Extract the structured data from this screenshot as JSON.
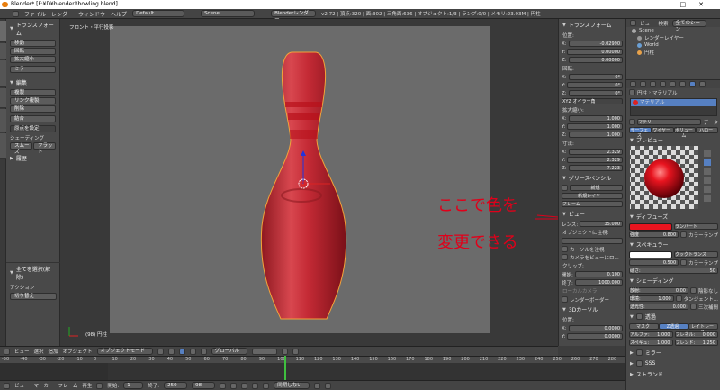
{
  "titlebar": {
    "title": "Blender* [F:¥D¥blender¥bowling.blend]",
    "controls": "–□✕"
  },
  "menubar": {
    "menus": [
      "ファイル",
      "レンダー",
      "ウィンドウ",
      "ヘルプ"
    ],
    "layout": "Default",
    "scene": "Scene",
    "engine": "Blenderレンダー",
    "stats": "v2.72 | 頂点:320 | 面:302 | 三角面:636 | オブジェクト:1/3 | ランプ:0/0 | メモリ:23.93M | 円柱"
  },
  "left_tabs": [
    "ツール",
    "作成",
    "リレーション",
    "アニメ",
    "物理演算",
    "グリース"
  ],
  "toolshelf": {
    "transform_header": "トランスフォーム",
    "transform_buttons": [
      "移動",
      "回転",
      "拡大縮小",
      "ミラー"
    ],
    "edit_header": "編集",
    "edit_buttons": [
      "複製",
      "リンク複製",
      "削除",
      "結合"
    ],
    "origin_button": "原点を設定",
    "shading_label": "シェーディング",
    "smooth_button": "スムーズ",
    "flat_button": "フラット",
    "history_header": "履歴",
    "select_all_header": "全てを選択(解除)",
    "action_label": "アクション",
    "action_value": "切り替え"
  },
  "viewport": {
    "label": "フロント・平行投影",
    "object_label": "(98) 円柱",
    "annotation_line1": "ここで色を",
    "annotation_line2": "変更できる"
  },
  "vp_header": {
    "items": [
      "ビュー",
      "選択",
      "追加",
      "オブジェクト"
    ],
    "mode": "オブジェクトモード",
    "orientation": "グローバル"
  },
  "timeline": {
    "ruler": [
      "-50",
      "-40",
      "-30",
      "-20",
      "-10",
      "0",
      "10",
      "20",
      "30",
      "40",
      "50",
      "60",
      "70",
      "80",
      "90",
      "100",
      "110",
      "120",
      "130",
      "140",
      "150",
      "160",
      "170",
      "180",
      "190",
      "200",
      "210",
      "220",
      "230",
      "240",
      "250",
      "260",
      "270",
      "280"
    ],
    "header_items": [
      "ビュー",
      "マーカー",
      "フレーム",
      "再生"
    ],
    "start_label": "開始:",
    "start_value": "1",
    "end_label": "終了:",
    "end_value": "250",
    "current": "98",
    "sync": "同期しない"
  },
  "n_panel": {
    "transform": "トランスフォーム",
    "location": "位置:",
    "loc": [
      {
        "k": "X:",
        "v": "-0.02990"
      },
      {
        "k": "Y:",
        "v": "0.00000"
      },
      {
        "k": "Z:",
        "v": "0.00000"
      }
    ],
    "rotation": "回転:",
    "rot": [
      {
        "k": "X:",
        "v": "0°"
      },
      {
        "k": "Y:",
        "v": "0°"
      },
      {
        "k": "Z:",
        "v": "0°"
      }
    ],
    "euler": "XYZ オイラー角",
    "scale": "拡大縮小:",
    "scl": [
      {
        "k": "X:",
        "v": "1.000"
      },
      {
        "k": "Y:",
        "v": "1.000"
      },
      {
        "k": "Z:",
        "v": "1.000"
      }
    ],
    "dimensions": "寸法:",
    "dim": [
      {
        "k": "X:",
        "v": "2.329"
      },
      {
        "k": "Y:",
        "v": "2.329"
      },
      {
        "k": "Z:",
        "v": "7.223"
      }
    ],
    "grease": "グリースペンシル",
    "new_btn": "新規",
    "new_layer": "新規レイヤー",
    "frame": "フレーム",
    "view": "ビュー",
    "lens_label": "レンズ:",
    "lens_value": "35.000",
    "lock_object": "オブジェクトに注視:",
    "lock_cursor": "カーソルを注視",
    "lock_camera": "カメラをビューにロ...",
    "clip": "クリップ:",
    "clip_start_label": "開始:",
    "clip_start": "0.100",
    "clip_end_label": "終了:",
    "clip_end": "1000.000",
    "local_camera": "ローカルカメラ",
    "render_border": "レンダーボーダー",
    "cursor3d": "3Dカーソル",
    "cursor_pos": "位置:",
    "cursor_x_label": "X:",
    "cursor_x": "0.0000",
    "cursor_y_label": "Y:",
    "cursor_y": "0.0000"
  },
  "outliner": {
    "header": [
      "ビュー",
      "検索",
      "全てのシーン"
    ],
    "rows": [
      "Scene",
      "レンダーレイヤー",
      "World",
      "円柱"
    ]
  },
  "material": {
    "breadcrumb_obj": "円柱",
    "breadcrumb_mat": "マテリアル",
    "slot": "マテリアル",
    "name_field": "マテリ",
    "data_label": "データ",
    "tabs": [
      "サーフェス",
      "ワイヤー",
      "ボリューム",
      "ハロー"
    ],
    "preview": "プレビュー",
    "diffuse": "ディフューズ",
    "diffuse_shader": "ランバート",
    "intensity_label": "強度",
    "intensity": "0.800",
    "ramp": "カラーランプ",
    "specular": "スペキュラー",
    "spec_shader": "クックトランス",
    "spec_intensity": "0.500",
    "hardness_label": "硬さ:",
    "hardness": "50",
    "shading": "シェーディング",
    "emit_label": "放射:",
    "emit": "0.00",
    "ambient_label": "環境:",
    "ambient": "1.000",
    "translucency_label": "透光性:",
    "translucency": "0.000",
    "shadeless": "陰影なし",
    "tangent": "タンジェント...",
    "cubic": "三次補間",
    "transparency": "透過",
    "mask": "マスク",
    "z_transp": "Z透過",
    "raytrace": "レイトレース",
    "alpha_label": "アルファ:",
    "alpha": "1.000",
    "fresnel_label": "フレネル:",
    "fresnel": "0.000",
    "specular2_label": "スペキュ:",
    "specular2": "1.000",
    "blend_label": "ブレンド:",
    "blend": "1.250",
    "mirror": "ミラー",
    "sss": "SSS",
    "strand": "ストランド"
  },
  "colors": {
    "diffuse_color": "#e8141f",
    "pin_color": "#c42a35",
    "annotation": "#e0001a",
    "selected_outline": "#f2a33a"
  }
}
